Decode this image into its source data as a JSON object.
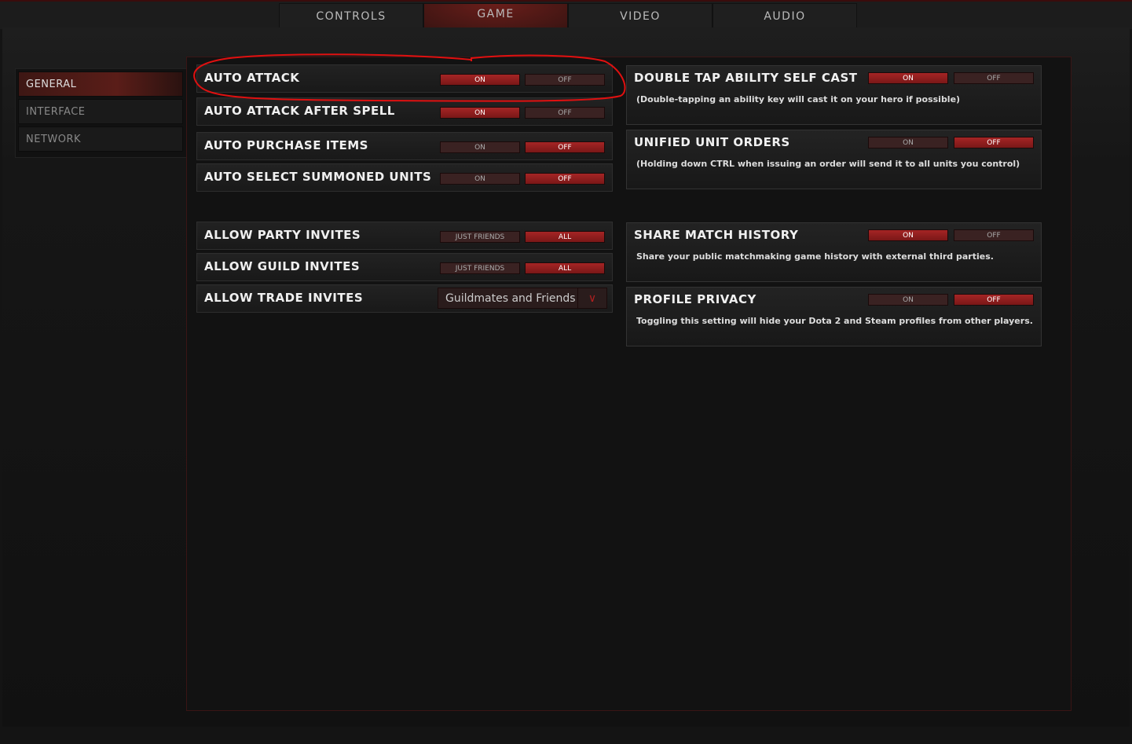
{
  "tabs": [
    {
      "label": "CONTROLS"
    },
    {
      "label": "GAME",
      "active": true
    },
    {
      "label": "VIDEO"
    },
    {
      "label": "AUDIO"
    }
  ],
  "sidebar": [
    {
      "label": "GENERAL",
      "active": true
    },
    {
      "label": "INTERFACE"
    },
    {
      "label": "NETWORK"
    }
  ],
  "left_settings": [
    {
      "label": "AUTO ATTACK",
      "options": [
        "ON",
        "OFF"
      ],
      "selected": "ON"
    },
    {
      "label": "AUTO ATTACK AFTER SPELL",
      "options": [
        "ON",
        "OFF"
      ],
      "selected": "ON"
    },
    {
      "label": "AUTO PURCHASE ITEMS",
      "options": [
        "ON",
        "OFF"
      ],
      "selected": "OFF"
    },
    {
      "label": "AUTO SELECT SUMMONED UNITS",
      "options": [
        "ON",
        "OFF"
      ],
      "selected": "OFF"
    },
    {
      "label": "ALLOW PARTY INVITES",
      "options": [
        "JUST FRIENDS",
        "ALL"
      ],
      "selected": "ALL"
    },
    {
      "label": "ALLOW GUILD INVITES",
      "options": [
        "JUST FRIENDS",
        "ALL"
      ],
      "selected": "ALL"
    }
  ],
  "trade": {
    "label": "ALLOW TRADE INVITES",
    "value": "Guildmates and Friends"
  },
  "right_settings": [
    {
      "label": "DOUBLE TAP ABILITY SELF CAST",
      "desc": "(Double-tapping an ability key will cast it on your hero if possible)",
      "options": [
        "ON",
        "OFF"
      ],
      "selected": "ON"
    },
    {
      "label": "UNIFIED UNIT ORDERS",
      "desc": "(Holding down CTRL when issuing an order will send it to all units you control)",
      "options": [
        "ON",
        "OFF"
      ],
      "selected": "OFF"
    },
    {
      "label": "SHARE MATCH HISTORY",
      "desc": "Share your public matchmaking game history with external third parties.",
      "options": [
        "ON",
        "OFF"
      ],
      "selected": "ON"
    },
    {
      "label": "PROFILE PRIVACY",
      "desc": "Toggling this setting will hide your Dota 2 and Steam profiles from other players.",
      "options": [
        "ON",
        "OFF"
      ],
      "selected": "OFF"
    }
  ],
  "colors": {
    "accent": "#a52525",
    "annotation": "#e01010"
  }
}
